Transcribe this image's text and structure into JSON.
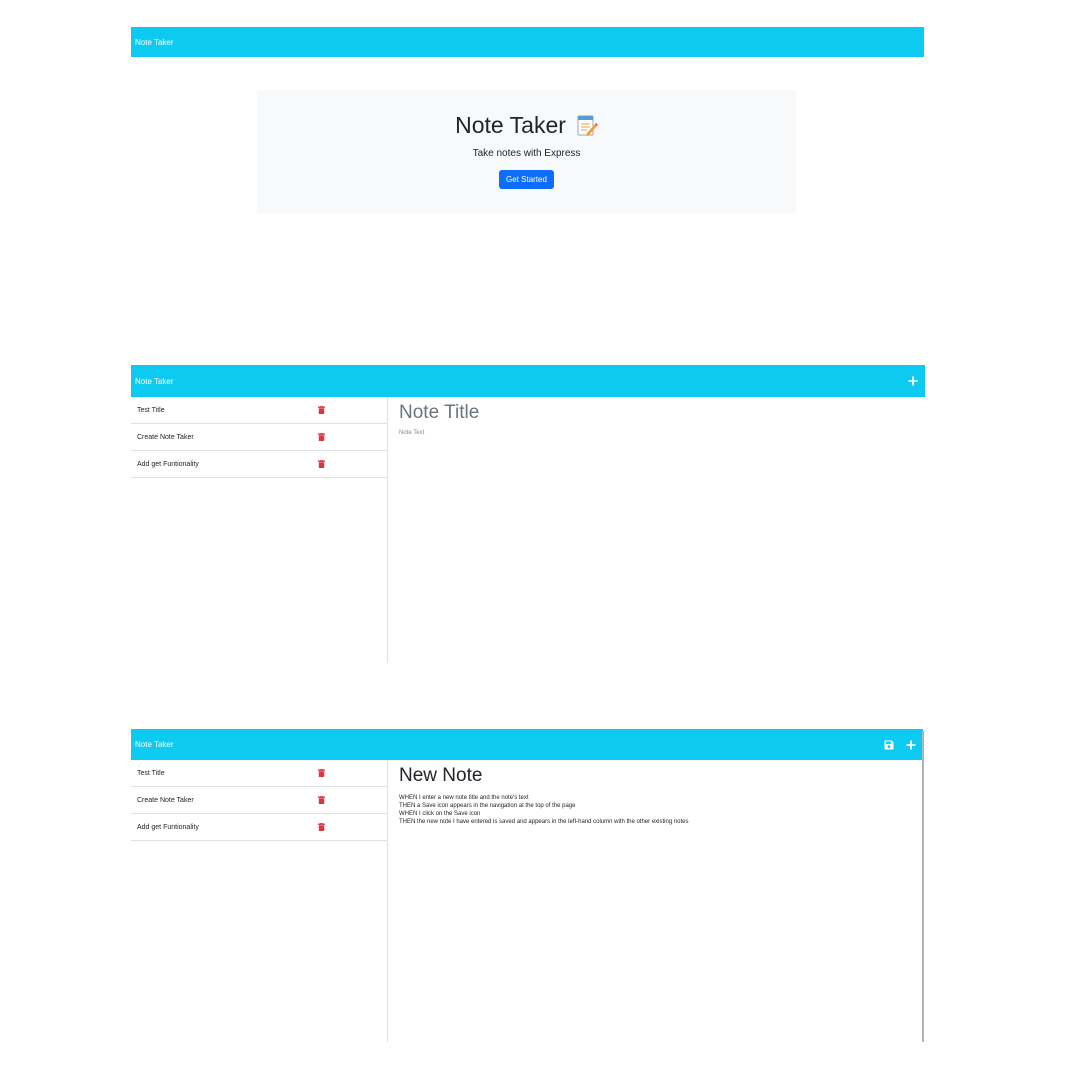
{
  "landing": {
    "brand": "Note Taker",
    "title": "Note Taker",
    "lead": "Take notes with Express",
    "cta_label": "Get Started"
  },
  "notes_view": {
    "brand": "Note Taker",
    "notes": [
      {
        "title": "Test Title"
      },
      {
        "title": "Create Note Taker"
      },
      {
        "title": "Add get Funtionality"
      }
    ],
    "title_placeholder": "Note Title",
    "text_placeholder": "Note Text"
  },
  "new_note_view": {
    "brand": "Note Taker",
    "notes": [
      {
        "title": "Test Title"
      },
      {
        "title": "Create Note Taker"
      },
      {
        "title": "Add get Funtionality"
      }
    ],
    "title": "New Note",
    "text_lines": [
      "WHEN I enter a new note title and the note's text",
      "THEN a Save icon appears in the navigation at the top of the page",
      "WHEN I click on the Save icon",
      "THEN the new note I have entered is saved and appears in the left-hand column with the other existing notes"
    ]
  },
  "icons": {
    "notepad": "notepad-pencil-icon",
    "add": "plus-icon",
    "save": "floppy-disk-icon",
    "delete": "trash-icon"
  },
  "colors": {
    "navbar": "#0dcaf0",
    "primary_button": "#0d6efd",
    "jumbotron": "#f8f9fa",
    "delete_icon": "#dc3545"
  }
}
